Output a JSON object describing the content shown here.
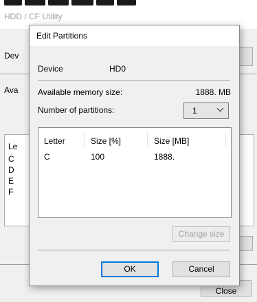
{
  "background_window": {
    "title": "HDD / CF Utility",
    "device_label_partial": "Dev",
    "available_label_partial": "Ava",
    "list_items_partial": [
      "Le",
      "C",
      "D",
      "E",
      "F"
    ],
    "close_label": "Close"
  },
  "dialog": {
    "title": "Edit Partitions",
    "device_label": "Device",
    "device_value": "HD0",
    "available_label": "Available memory size:",
    "available_value": "1888. MB",
    "partitions_label": "Number of partitions:",
    "partitions_value": "1",
    "table": {
      "columns": [
        "Letter",
        "Size [%]",
        "Size [MB]"
      ],
      "rows": [
        {
          "letter": "C",
          "size_pct": "100",
          "size_mb": "1888."
        }
      ]
    },
    "change_size_label": "Change size",
    "ok_label": "OK",
    "cancel_label": "Cancel"
  },
  "colors": {
    "accent": "#0078d7",
    "dialog_bg": "#f0f0f0",
    "disabled_text": "#a0a0a0"
  }
}
